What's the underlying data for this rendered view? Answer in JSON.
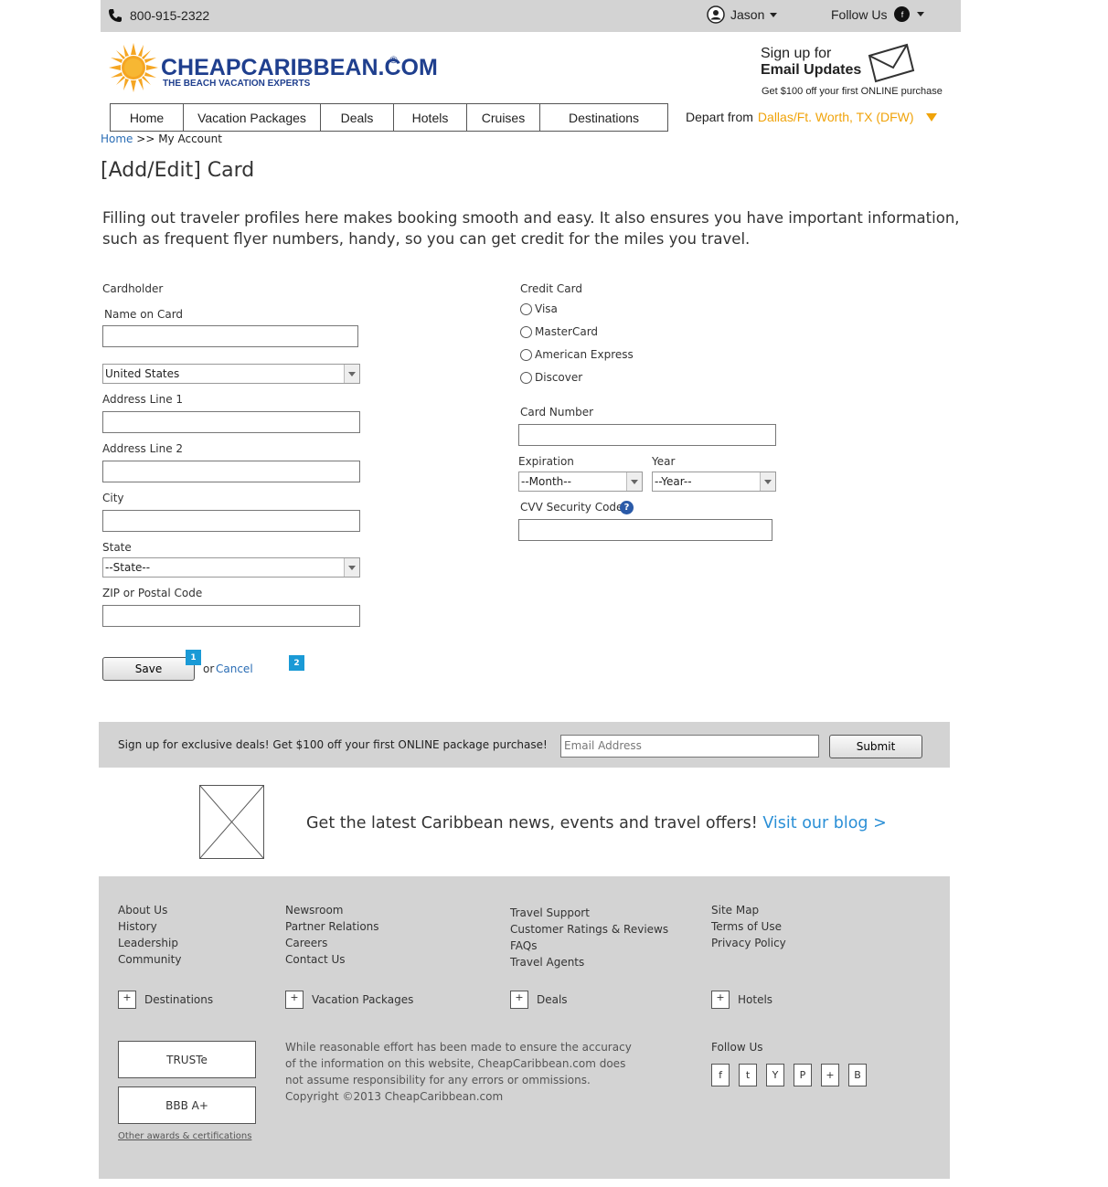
{
  "topbar": {
    "phone": "800-915-2322",
    "user_name": "Jason",
    "follow_label": "Follow Us",
    "fb_glyph": "f"
  },
  "brand": {
    "name": "CHEAPCARIBBEAN.COM",
    "tagline": "THE BEACH VACATION EXPERTS",
    "registered": "®",
    "primary_color": "#1f3f8e",
    "sun_color": "#f5a623"
  },
  "email_promo": {
    "line1": "Sign up for",
    "line2": "Email Updates",
    "line3": "Get $100 off your first ONLINE purchase"
  },
  "nav": {
    "tabs": [
      {
        "label": "Home"
      },
      {
        "label": "Vacation Packages"
      },
      {
        "label": "Deals"
      },
      {
        "label": "Hotels"
      },
      {
        "label": "Cruises"
      },
      {
        "label": "Destinations"
      }
    ],
    "depart_label": "Depart from",
    "depart_city": "Dallas/Ft. Worth, TX (DFW)"
  },
  "breadcrumb": {
    "home": "Home",
    "separator": ">>",
    "current": "My Account"
  },
  "page": {
    "title": "[Add/Edit] Card",
    "intro": "Filling out traveler profiles here makes booking smooth and easy. It also ensures you have important information, such as frequent flyer numbers, handy, so you can get credit for the miles you travel."
  },
  "cardholder": {
    "section_label": "Cardholder",
    "name_label": "Name on Card",
    "name_value": "",
    "country_value": "United States",
    "address1_label": "Address Line 1",
    "address2_label": "Address Line 2",
    "city_label": "City",
    "state_label": "State",
    "state_value": "--State--",
    "zip_label": "ZIP or Postal Code"
  },
  "credit_card": {
    "section_label": "Credit Card",
    "types": [
      {
        "label": "Visa"
      },
      {
        "label": "MasterCard"
      },
      {
        "label": "American Express"
      },
      {
        "label": "Discover"
      }
    ],
    "number_label": "Card Number",
    "expiration_label": "Expiration",
    "month_value": "--Month--",
    "year_label": "Year",
    "year_value": "--Year--",
    "cvv_label": "CVV Security Code",
    "help_glyph": "?"
  },
  "actions": {
    "save_label": "Save",
    "or_text": "or",
    "cancel_label": "Cancel",
    "badge1": "1",
    "badge2": "2"
  },
  "signup": {
    "text": "Sign up for exclusive deals! Get $100 off your first ONLINE package purchase!",
    "email_placeholder": "Email Address",
    "submit_label": "Submit"
  },
  "blog": {
    "text": "Get the latest Caribbean news, events and travel offers!",
    "link": "Visit our blog >"
  },
  "footer": {
    "col1": [
      "About Us",
      "History",
      "Leadership",
      "Community"
    ],
    "col2": [
      "Newsroom",
      "Partner Relations",
      "Careers",
      "Contact Us"
    ],
    "col3": [
      "Travel Support",
      "Customer Ratings & Reviews",
      "FAQs",
      "Travel Agents"
    ],
    "col4": [
      "Site Map",
      "Terms of Use",
      "Privacy Policy"
    ],
    "expanders": [
      "Destinations",
      "Vacation Packages",
      "Deals",
      "Hotels"
    ],
    "plus_glyph": "+",
    "awards": [
      "TRUSTe",
      "BBB A+"
    ],
    "awards_link": "Other awards & certifications",
    "disclaimer": "While reasonable effort has been made to ensure the accuracy of the information on this website, CheapCaribbean.com does not assume responsibility for any errors or ommissions.",
    "copyright": "Copyright ©2013 CheapCaribbean.com",
    "follow_label": "Follow Us",
    "social": [
      "f",
      "t",
      "Y",
      "P",
      "+",
      "B"
    ]
  }
}
